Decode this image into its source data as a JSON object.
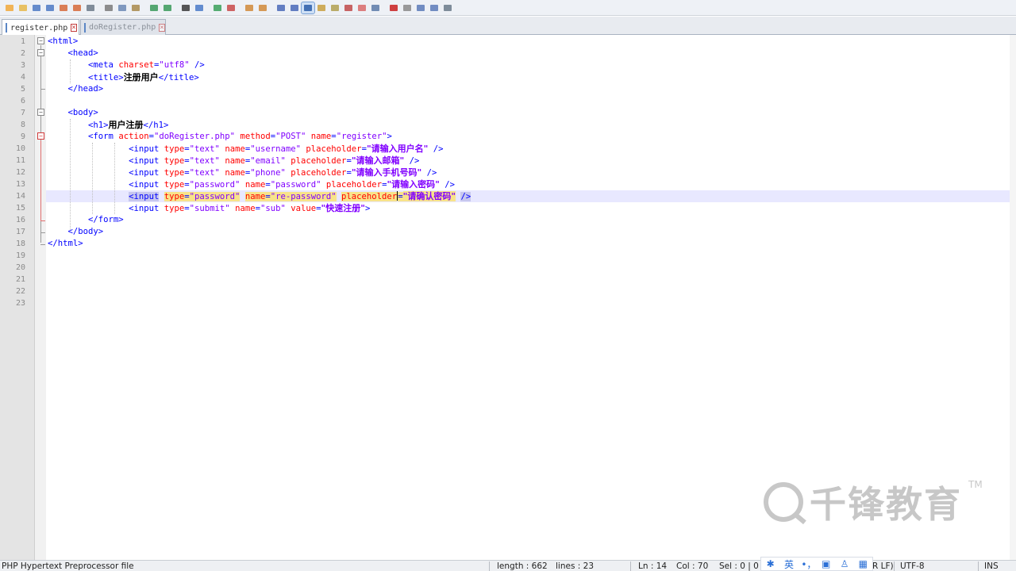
{
  "toolbar": {
    "icons": [
      "new-file-icon",
      "open-file-icon",
      "save-icon",
      "save-all-icon",
      "close-icon",
      "close-all-icon",
      "print-icon",
      "cut-icon",
      "copy-icon",
      "paste-icon",
      "undo-icon",
      "redo-icon",
      "find-icon",
      "replace-icon",
      "zoom-in-icon",
      "zoom-out-icon",
      "sync-v-icon",
      "sync-h-icon",
      "word-wrap-icon",
      "show-all-chars-icon",
      "indent-guide-icon",
      "user-lang-icon",
      "doc-map-icon",
      "function-list-icon",
      "folder-workspace-icon",
      "monitor-icon",
      "record-macro-icon",
      "stop-macro-icon",
      "play-macro-icon",
      "run-macro-icon",
      "save-macro-icon"
    ],
    "accent": "#2a5ca8"
  },
  "tabs": [
    {
      "label": "register.php",
      "active": true
    },
    {
      "label": "doRegister.php",
      "active": false
    }
  ],
  "editor": {
    "line_numbers": [
      "1",
      "2",
      "3",
      "4",
      "5",
      "6",
      "7",
      "8",
      "9",
      "10",
      "11",
      "12",
      "13",
      "14",
      "15",
      "16",
      "17",
      "18",
      "19",
      "20",
      "21",
      "22",
      "23"
    ],
    "lines": {
      "l1": {
        "open": "<html>"
      },
      "l2": {
        "open": "<head>"
      },
      "l3": {
        "tag": "<meta",
        "a1": "charset",
        "eq1": "=",
        "v1": "\"utf8\"",
        "close": " />"
      },
      "l4": {
        "open": "<title>",
        "text": "注册用户",
        "close": "</title>"
      },
      "l5": {
        "close": "</head>"
      },
      "l7": {
        "open": "<body>"
      },
      "l8": {
        "open": "<h1>",
        "text": "用户注册",
        "close": "</h1>"
      },
      "l9": {
        "tag": "<form",
        "a1": "action",
        "v1": "\"doRegister.php\"",
        "a2": "method",
        "v2": "\"POST\"",
        "a3": "name",
        "v3": "\"register\"",
        "close": ">"
      },
      "l10": {
        "tag": "<input",
        "a1": "type",
        "v1": "\"text\"",
        "a2": "name",
        "v2": "\"username\"",
        "a3": "placeholder",
        "v3": "\"请输入用户名\"",
        "close": " />"
      },
      "l11": {
        "tag": "<input",
        "a1": "type",
        "v1": "\"text\"",
        "a2": "name",
        "v2": "\"email\"",
        "a3": "placeholder",
        "v3": "\"请输入邮箱\"",
        "close": " />"
      },
      "l12": {
        "tag": "<input",
        "a1": "type",
        "v1": "\"text\"",
        "a2": "name",
        "v2": "\"phone\"",
        "a3": "placeholder",
        "v3": "\"请输入手机号码\"",
        "close": " />"
      },
      "l13": {
        "tag": "<input",
        "a1": "type",
        "v1": "\"password\"",
        "a2": "name",
        "v2": "\"password\"",
        "a3": "placeholder",
        "v3": "\"请输入密码\"",
        "close": " />"
      },
      "l14": {
        "tag": "<input",
        "a1": "type",
        "v1": "\"password\"",
        "a2": "name",
        "v2": "\"re-password\"",
        "a3": "placeholder",
        "v3": "\"请确认密码\"",
        "close": "/>"
      },
      "l15": {
        "tag": "<input",
        "a1": "type",
        "v1": "\"submit\"",
        "a2": "name",
        "v2": "\"sub\"",
        "a3": "value",
        "v3": "\"快速注册\"",
        "close": ">"
      },
      "l16": {
        "close": "</form>"
      },
      "l17": {
        "close": "</body>"
      },
      "l18": {
        "close": "</html>"
      }
    },
    "current_line_color": "#e8e8ff"
  },
  "watermark": {
    "text": "千锋教育",
    "tm": "TM"
  },
  "status": {
    "language": "PHP Hypertext Preprocessor file",
    "length": "length : 662",
    "lines": "lines : 23",
    "ln": "Ln : 14",
    "col": "Col : 70",
    "sel": "Sel : 0 | 0",
    "eol": "R LF)",
    "encoding": "UTF-8",
    "mode": "INS"
  },
  "ime": {
    "lang": "英",
    "punct": "•，"
  }
}
